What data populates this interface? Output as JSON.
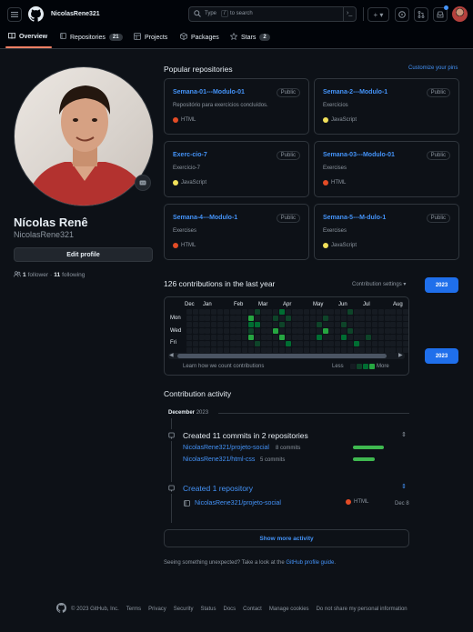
{
  "header": {
    "username": "NicolasRene321",
    "search_prefix": "Type",
    "search_key": "/",
    "search_suffix": "to search"
  },
  "tabs": [
    {
      "label": "Overview"
    },
    {
      "label": "Repositories",
      "count": "21"
    },
    {
      "label": "Projects"
    },
    {
      "label": "Packages"
    },
    {
      "label": "Stars",
      "count": "2"
    }
  ],
  "profile": {
    "fullname": "Nícolas Renê",
    "username": "NicolasRene321",
    "edit_label": "Edit profile",
    "followers_count": "1",
    "followers_label": "follower",
    "following_count": "11",
    "following_label": "following"
  },
  "popular": {
    "title": "Popular repositories",
    "customize": "Customize your pins",
    "repos": [
      {
        "name": "Semana-01---Modulo-01",
        "badge": "Public",
        "desc": "Repositório para exercícios concluídos.",
        "lang": "HTML",
        "color": "#e34c26"
      },
      {
        "name": "Semana-2---Modulo-1",
        "badge": "Public",
        "desc": "Exercícios",
        "lang": "JavaScript",
        "color": "#f1e05a"
      },
      {
        "name": "Exerc-cio-7",
        "badge": "Public",
        "desc": "Exercício-7",
        "lang": "JavaScript",
        "color": "#f1e05a"
      },
      {
        "name": "Semana-03---Modulo-01",
        "badge": "Public",
        "desc": "Exercises",
        "lang": "HTML",
        "color": "#e34c26"
      },
      {
        "name": "Semana-4---Modulo-1",
        "badge": "Public",
        "desc": "Exercises",
        "lang": "HTML",
        "color": "#e34c26"
      },
      {
        "name": "Semana-5---M-dulo-1",
        "badge": "Public",
        "desc": "Exercises",
        "lang": "JavaScript",
        "color": "#f1e05a"
      }
    ]
  },
  "contributions": {
    "title": "126 contributions in the last year",
    "settings": "Contribution settings",
    "year_btn": "2023",
    "year_btn2": "2023",
    "months": [
      "Dec",
      "Jan",
      "Feb",
      "Mar",
      "Apr",
      "May",
      "Jun",
      "Jul",
      "Aug"
    ],
    "days": [
      "Mon",
      "Wed",
      "Fri"
    ],
    "learn": "Learn how we count contributions",
    "less": "Less",
    "more": "More"
  },
  "activity": {
    "title": "Contribution activity",
    "month": "December",
    "year": "2023",
    "commits_title": "Created 11 commits in 2 repositories",
    "commit_repos": [
      {
        "name": "NicolasRene321/projeto-social",
        "count": "8 commits",
        "fraction": 0.73
      },
      {
        "name": "NicolasRene321/html-css",
        "count": "5 commits",
        "fraction": 0.5
      }
    ],
    "created_title": "Created 1 repository",
    "created_repo": "NicolasRene321/projeto-social",
    "created_lang": "HTML",
    "created_date": "Dec 8",
    "show_more": "Show more activity",
    "unexpected_prefix": "Seeing something unexpected? Take a look at the",
    "unexpected_link": "GitHub profile guide",
    "unexpected_suffix": "."
  },
  "footer": {
    "copyright": "© 2023 GitHub, Inc.",
    "links": [
      "Terms",
      "Privacy",
      "Security",
      "Status",
      "Docs",
      "Contact",
      "Manage cookies",
      "Do not share my personal information"
    ]
  }
}
